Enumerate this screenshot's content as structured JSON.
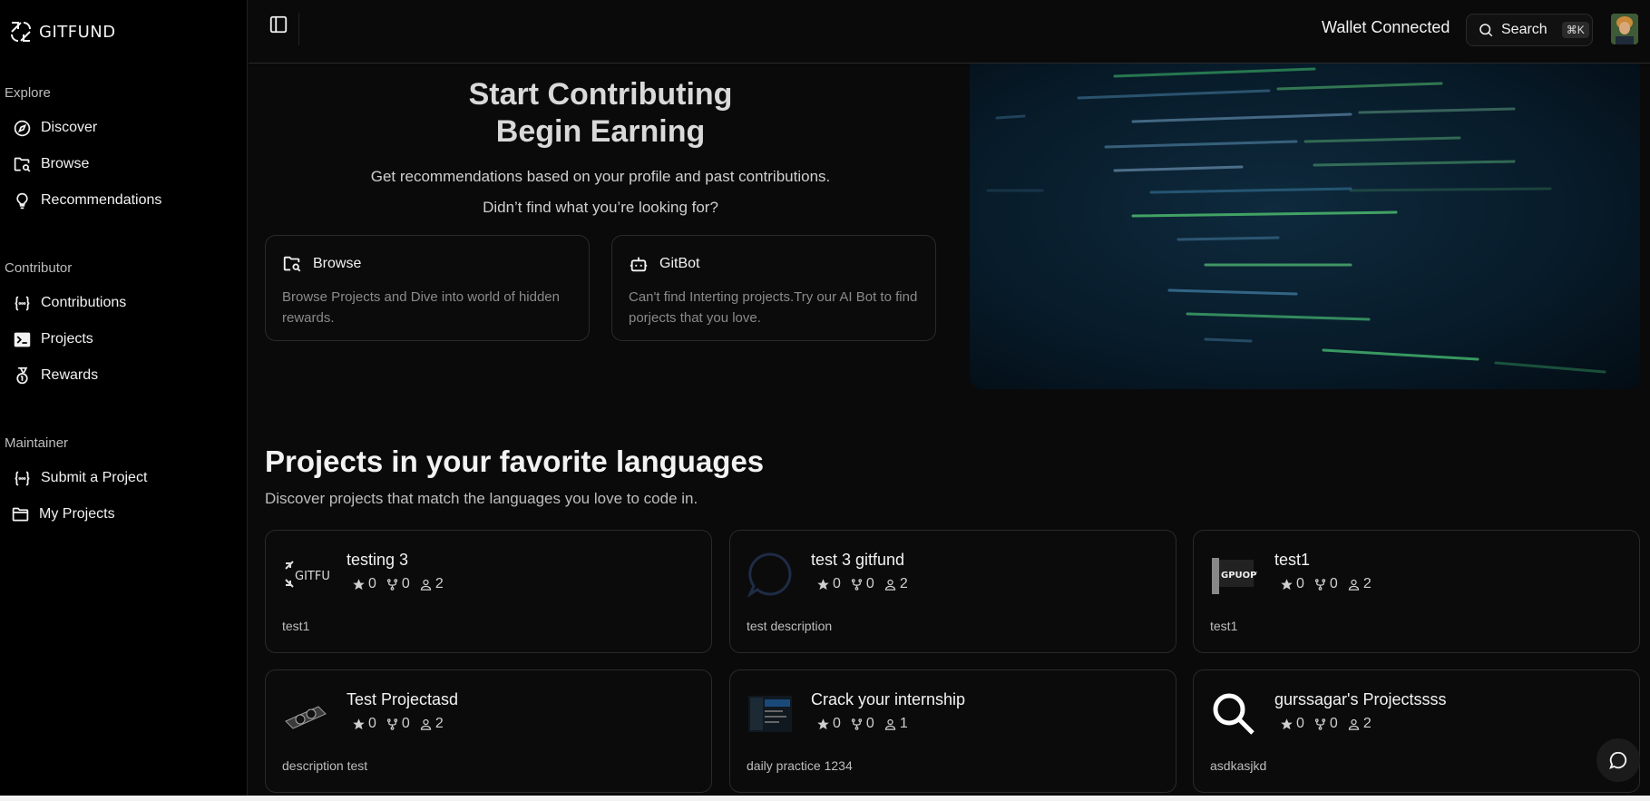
{
  "brand": {
    "name": "GITFUND"
  },
  "sidebar": {
    "explore": {
      "title": "Explore",
      "items": [
        {
          "label": "Discover",
          "icon": "compass-icon"
        },
        {
          "label": "Browse",
          "icon": "folder-search-icon"
        },
        {
          "label": "Recommendations",
          "icon": "lightbulb-icon"
        }
      ]
    },
    "contributor": {
      "title": "Contributor",
      "items": [
        {
          "label": "Contributions",
          "icon": "braces-icon"
        },
        {
          "label": "Projects",
          "icon": "terminal-icon"
        },
        {
          "label": "Rewards",
          "icon": "medal-icon"
        }
      ]
    },
    "maintainer": {
      "title": "Maintainer",
      "items": [
        {
          "label": "Submit a Project",
          "icon": "braces-icon"
        },
        {
          "label": "My Projects",
          "icon": "folder-icon"
        }
      ]
    }
  },
  "header": {
    "wallet_status": "Wallet Connected",
    "search_label": "Search",
    "search_shortcut": "⌘K"
  },
  "hero": {
    "title_line1": "Start Contributing",
    "title_line2": "Begin Earning",
    "subtitle": "Get recommendations based on your profile and past contributions.",
    "prompt": "Didn’t find what you’re looking for?",
    "cards": [
      {
        "title": "Browse",
        "icon": "folder-search-icon",
        "description": "Browse Projects and Dive into world of hidden rewards."
      },
      {
        "title": "GitBot",
        "icon": "bot-icon",
        "description": "Can't find Interting projects.Try our AI Bot to find porjects that you love."
      }
    ]
  },
  "projects_section": {
    "title": "Projects in your favorite languages",
    "subtitle": "Discover projects that match the languages you love to code in.",
    "projects": [
      {
        "name": "testing 3",
        "stars": "0",
        "forks": "0",
        "contributors": "2",
        "description": "test1",
        "thumb": "gitfund-logo"
      },
      {
        "name": "test 3 gitfund",
        "stars": "0",
        "forks": "0",
        "contributors": "2",
        "description": "test description",
        "thumb": "chat-bubble"
      },
      {
        "name": "test1",
        "stars": "0",
        "forks": "0",
        "contributors": "2",
        "description": "test1",
        "thumb": "hardware-logo"
      },
      {
        "name": "Test Projectasd",
        "stars": "0",
        "forks": "0",
        "contributors": "2",
        "description": "description test",
        "thumb": "gpu-card"
      },
      {
        "name": "Crack your internship",
        "stars": "0",
        "forks": "0",
        "contributors": "1",
        "description": "daily practice 1234",
        "thumb": "screenshot"
      },
      {
        "name": "gurssagar's Projectssss",
        "stars": "0",
        "forks": "0",
        "contributors": "2",
        "description": "asdkasjkd",
        "thumb": "magnifier"
      }
    ]
  },
  "colors": {
    "background": "#0a0a0a",
    "sidebar": "#000000",
    "border": "#2a2a2a",
    "muted_text": "#8a8a8a"
  }
}
